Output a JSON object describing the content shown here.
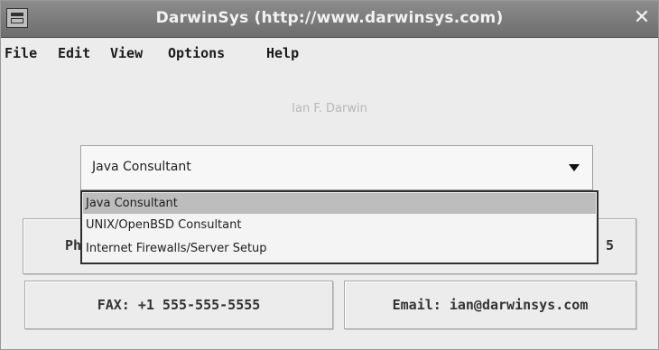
{
  "window": {
    "title": "DarwinSys (http://www.darwinsys.com)",
    "close_glyph": "✕"
  },
  "menubar": {
    "items": [
      "File",
      "Edit",
      "View",
      "Options",
      "Help"
    ]
  },
  "main": {
    "name_label": "Ian F. Darwin",
    "combo": {
      "selected_value": "Java Consultant",
      "options": [
        "Java Consultant",
        "UNIX/OpenBSD Consultant",
        "Internet Firewalls/Server Setup"
      ],
      "highlighted_index": 0
    },
    "phone_button": {
      "label_start": "Ph",
      "label_end": "5"
    },
    "fax_button": {
      "label": "FAX: +1 555-555-5555"
    },
    "email_button": {
      "label": "Email: ian@darwinsys.com"
    }
  },
  "colors": {
    "titlebar": "#7a7a7a",
    "window_bg": "#ececec",
    "selection": "#bdbdbd"
  }
}
